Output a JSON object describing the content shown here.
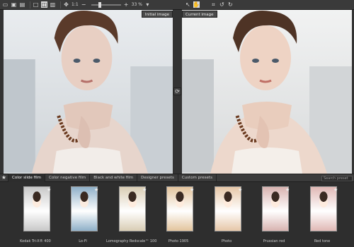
{
  "toolbar": {
    "icons": [
      "open-icon",
      "save-icon",
      "print-icon",
      "view-single-icon",
      "view-split-icon",
      "view-side-icon",
      "pan-icon"
    ],
    "ratio_label": "1:1",
    "zoom_label": "33 %",
    "zoom_level": 0.25
  },
  "viewer": {
    "initial_label": "Initial image",
    "current_label": "Current image"
  },
  "presets": {
    "tabs": [
      "Color slide film",
      "Color negative film",
      "Black and white film",
      "Designer presets",
      "Custom presets"
    ],
    "search_placeholder": "Search preset",
    "items": [
      {
        "label": "Kodak Tri-X® 400",
        "tint": "#c8c8c8"
      },
      {
        "label": "Lo-Fi",
        "tint": "#8fb0c8"
      },
      {
        "label": "Lomography Redscale™ 100",
        "tint": "#d9cdb4"
      },
      {
        "label": "Photo 1905",
        "tint": "#e3c49d"
      },
      {
        "label": "Photo",
        "tint": "#e6c7a8"
      },
      {
        "label": "Prussian red",
        "tint": "#d8b3b0"
      },
      {
        "label": "Red tone",
        "tint": "#e0b8b5"
      }
    ]
  },
  "colors": {
    "accent": "#d9d9d9",
    "background": "#2b2b2b"
  }
}
